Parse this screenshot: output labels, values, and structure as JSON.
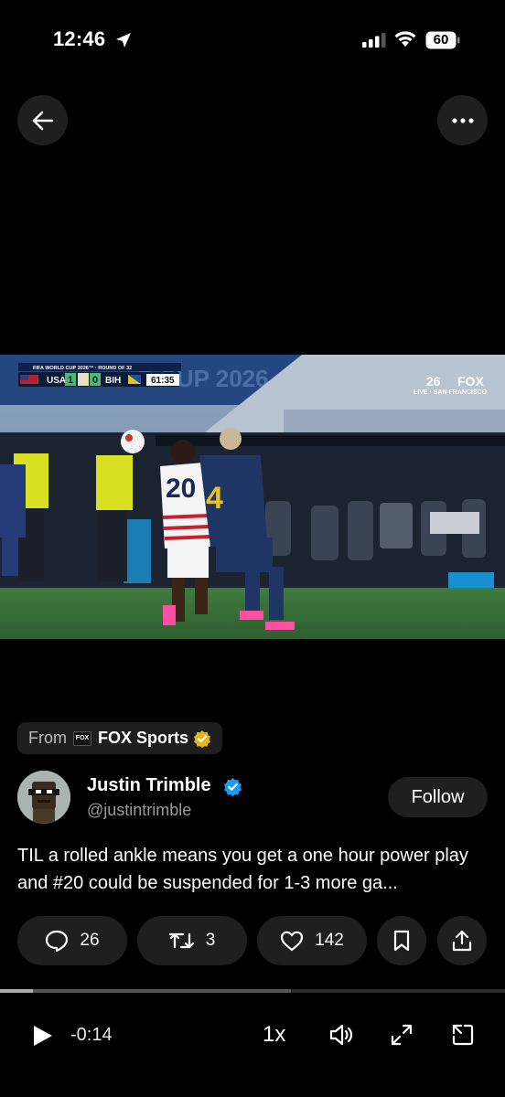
{
  "status_bar": {
    "time": "12:46",
    "battery": "60",
    "icons": [
      "location-arrow-icon",
      "signal-bars-icon",
      "wifi-icon",
      "battery-icon"
    ]
  },
  "nav": {
    "back_icon": "back-arrow-icon",
    "more_icon": "more-dots-icon"
  },
  "video": {
    "scorebug": {
      "competition": "FIFA WORLD CUP 2026™ · ROUND OF 32",
      "team_home": "USA",
      "score_home": "1",
      "score_away": "0",
      "team_away": "BIH",
      "clock": "61:35"
    },
    "broadcaster": {
      "channel": "FOX",
      "tagline": "LIVE · SAN FRANCISCO"
    },
    "banner_text": "P CUP 2026",
    "jersey_numbers": [
      "20",
      "4"
    ]
  },
  "source_chip": {
    "label": "From",
    "logo": "FOX",
    "name": "FOX Sports"
  },
  "author": {
    "name": "Justin Trimble",
    "handle": "@justintrimble",
    "follow_label": "Follow"
  },
  "post": {
    "text": "TIL a rolled ankle means you get a one hour power play and #20 could be suspended for 1-3 more ga..."
  },
  "actions": {
    "replies": "26",
    "reposts": "3",
    "likes": "142"
  },
  "player": {
    "progress_fraction": 0.065,
    "buffered_fraction": 0.576,
    "remaining_time": "-0:14",
    "speed": "1x"
  },
  "colors": {
    "background": "#000000",
    "pill": "#1f1f1f",
    "verified_blue": "#1d9bf0",
    "verified_gold": "#e2b719"
  }
}
